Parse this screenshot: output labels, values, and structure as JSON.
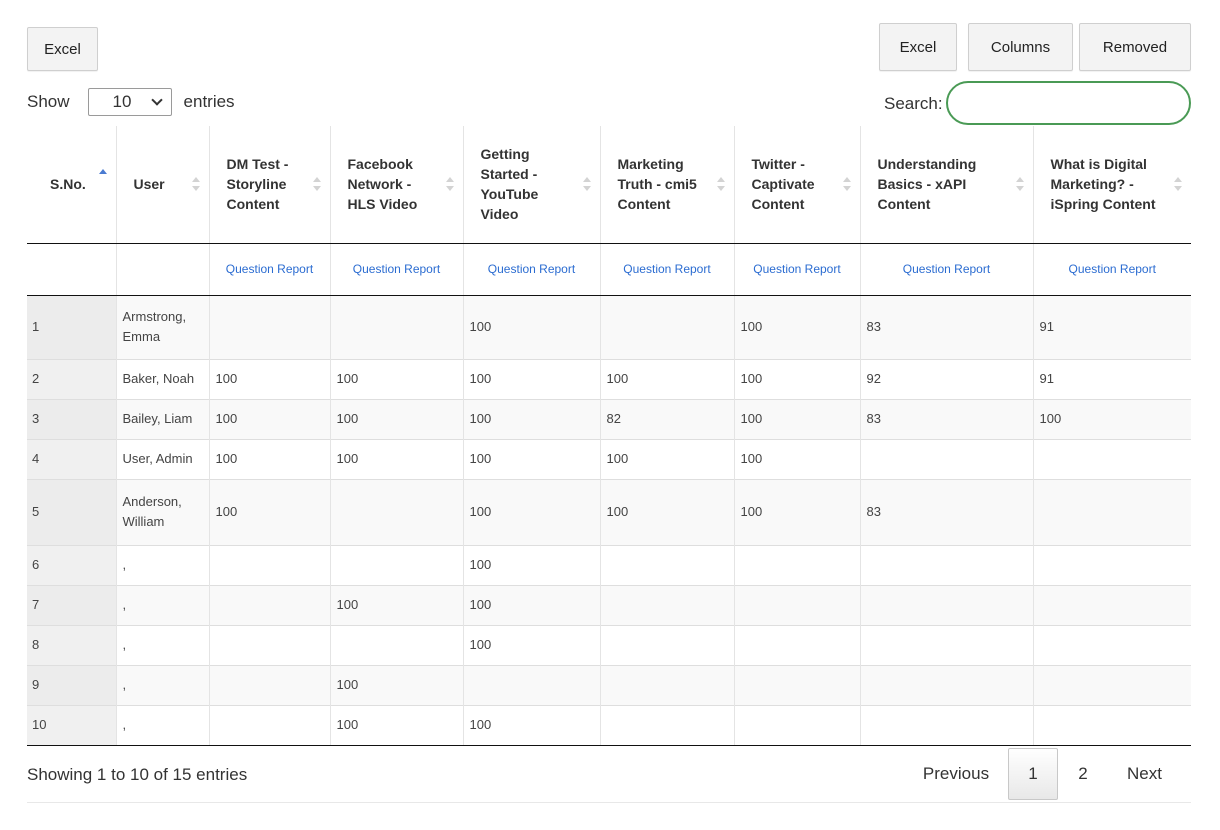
{
  "toolbar": {
    "left_excel": "Excel",
    "right_excel": "Excel",
    "columns": "Columns",
    "removed": "Removed"
  },
  "length_menu": {
    "prefix": "Show",
    "value": "10",
    "suffix": "entries"
  },
  "search": {
    "label": "Search:",
    "value": ""
  },
  "columns": [
    {
      "label": "S.No.",
      "sort": "asc"
    },
    {
      "label": "User",
      "sort": "both"
    },
    {
      "label": "DM Test - Storyline Content",
      "sort": "both"
    },
    {
      "label": "Facebook Network - HLS Video",
      "sort": "both"
    },
    {
      "label": "Getting Started - YouTube Video",
      "sort": "both"
    },
    {
      "label": "Marketing Truth - cmi5 Content",
      "sort": "both"
    },
    {
      "label": "Twitter - Captivate Content",
      "sort": "both"
    },
    {
      "label": "Understanding Basics - xAPI Content",
      "sort": "both"
    },
    {
      "label": "What is Digital Marketing? - iSpring Content",
      "sort": "both"
    }
  ],
  "report_link": "Question Report",
  "rows": [
    [
      "1",
      "Armstrong, Emma",
      "",
      "",
      "100",
      "",
      "100",
      "83",
      "91"
    ],
    [
      "2",
      "Baker, Noah",
      "100",
      "100",
      "100",
      "100",
      "100",
      "92",
      "91"
    ],
    [
      "3",
      "Bailey, Liam",
      "100",
      "100",
      "100",
      "82",
      "100",
      "83",
      "100"
    ],
    [
      "4",
      "User, Admin",
      "100",
      "100",
      "100",
      "100",
      "100",
      "",
      ""
    ],
    [
      "5",
      "Anderson, William",
      "100",
      "",
      "100",
      "100",
      "100",
      "83",
      ""
    ],
    [
      "6",
      ",",
      "",
      "",
      "100",
      "",
      "",
      "",
      ""
    ],
    [
      "7",
      ",",
      "",
      "100",
      "100",
      "",
      "",
      "",
      ""
    ],
    [
      "8",
      ",",
      "",
      "",
      "100",
      "",
      "",
      "",
      ""
    ],
    [
      "9",
      ",",
      "",
      "100",
      "",
      "",
      "",
      "",
      ""
    ],
    [
      "10",
      ",",
      "",
      "100",
      "100",
      "",
      "",
      "",
      ""
    ]
  ],
  "info": "Showing 1 to 10 of 15 entries",
  "pagination": {
    "previous": "Previous",
    "pages": [
      "1",
      "2"
    ],
    "current": "1",
    "next": "Next"
  }
}
